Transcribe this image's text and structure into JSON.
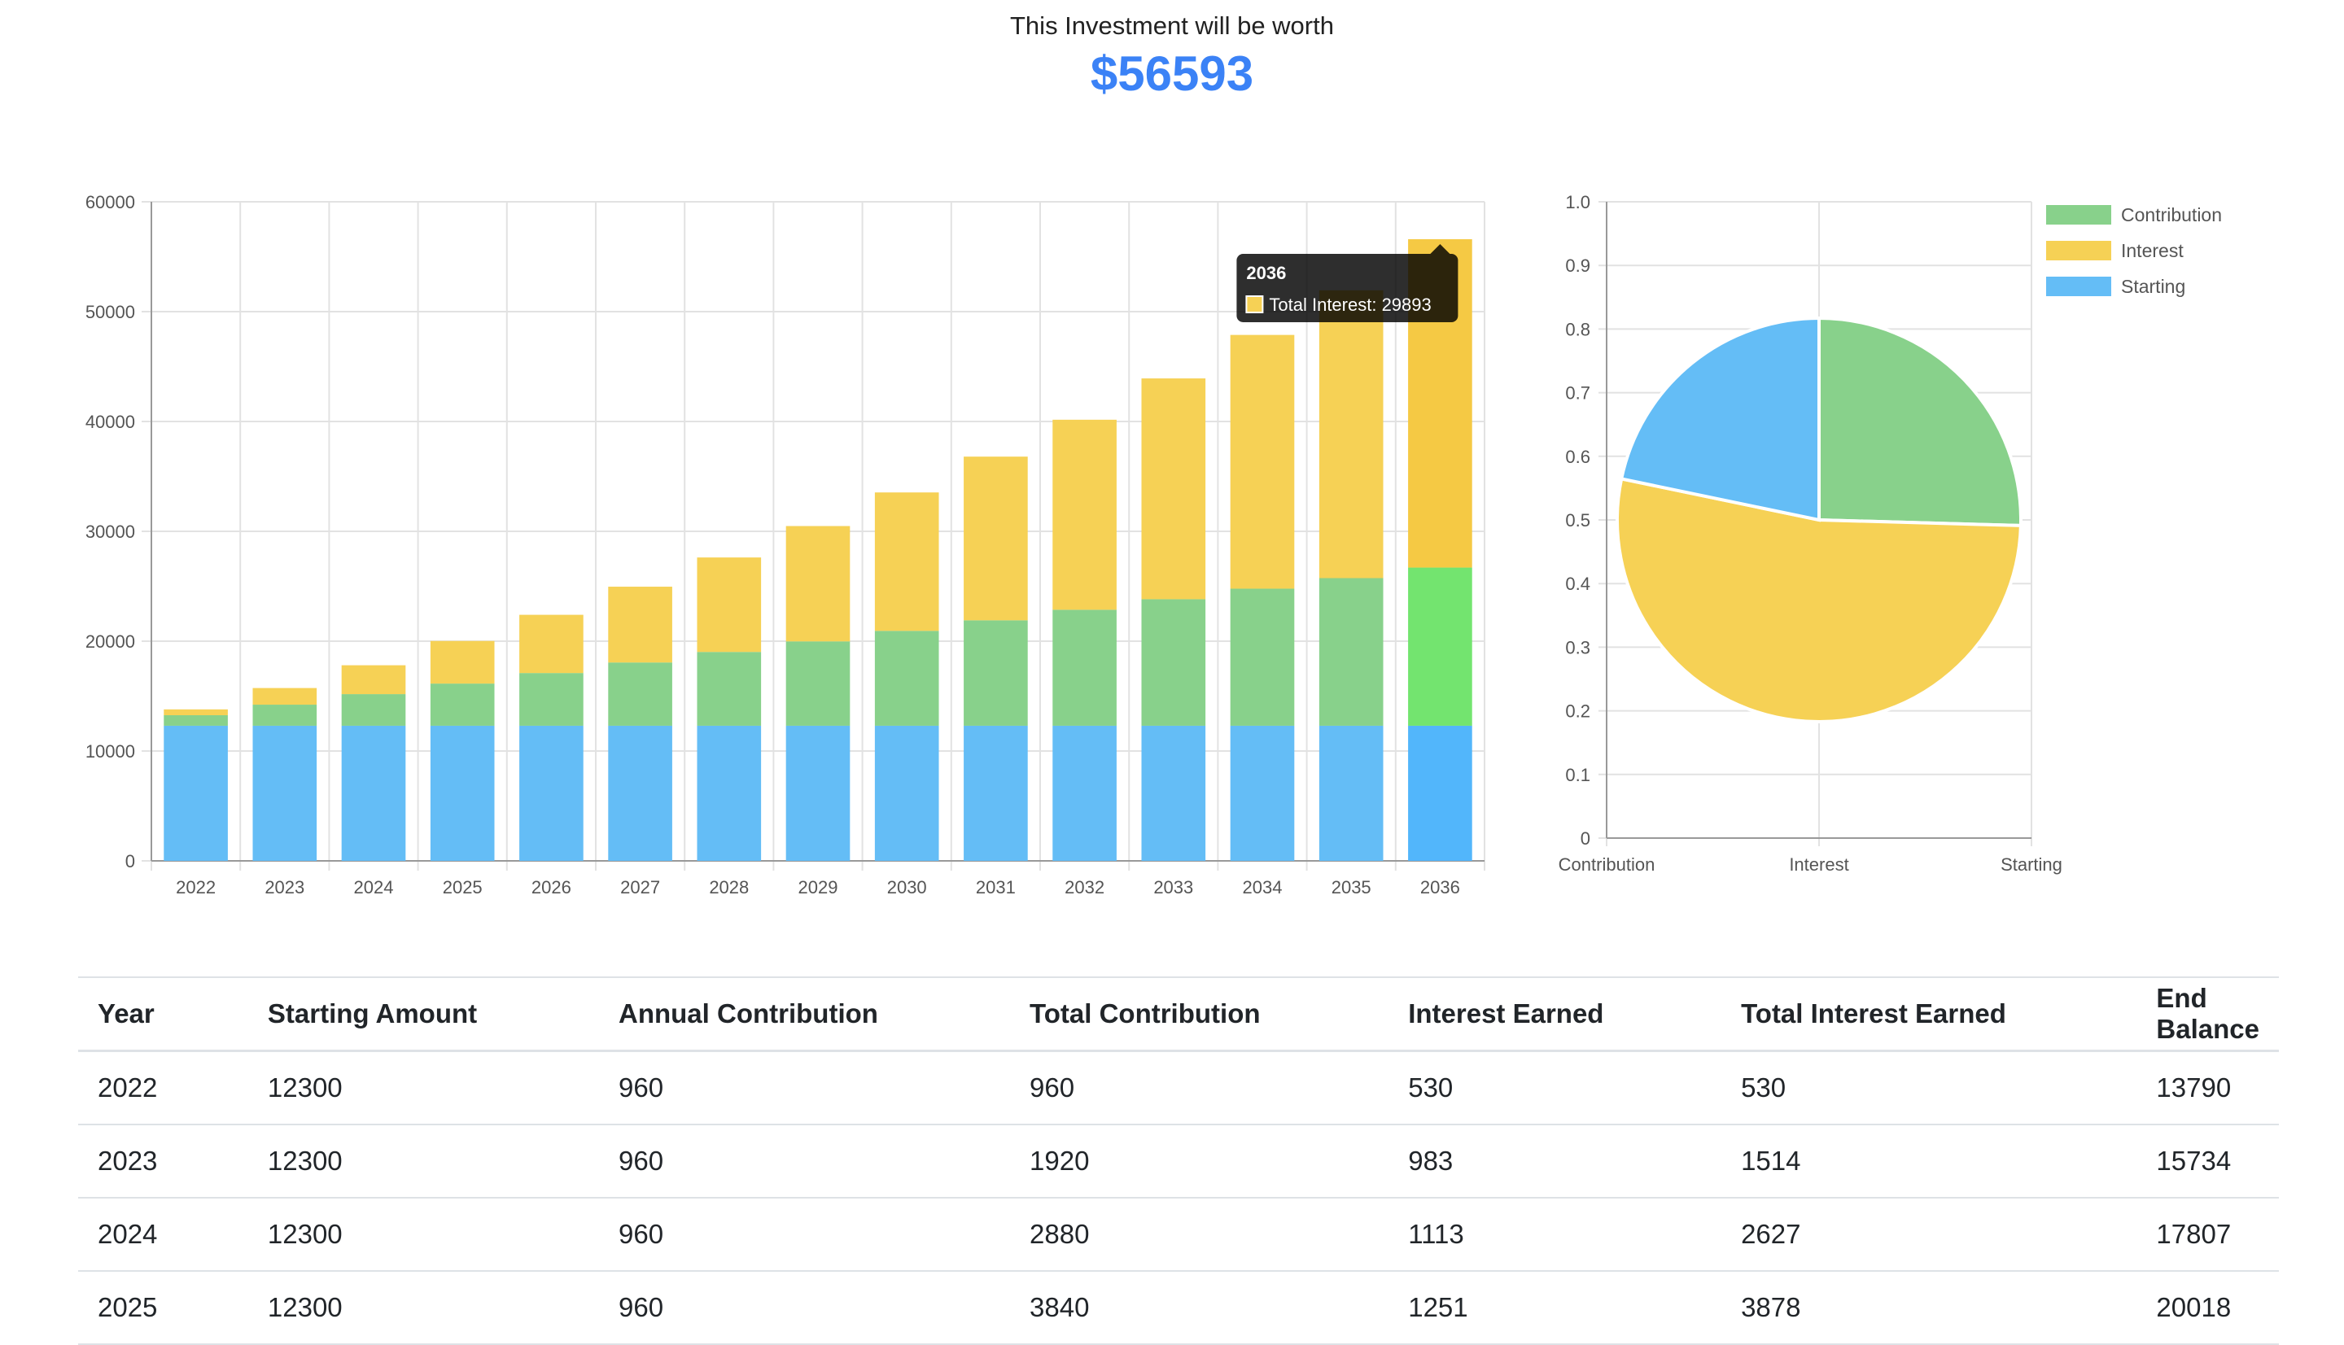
{
  "header": {
    "caption": "This Investment will be worth",
    "amount": "$56593"
  },
  "colors": {
    "contribution": "#88d18b",
    "interest": "#f6d155",
    "starting": "#64bdf6",
    "hl_contribution": "#73e46f",
    "hl_interest": "#f5c944",
    "hl_starting": "#52b6fb"
  },
  "chart_data": [
    {
      "type": "bar",
      "stacked": true,
      "categories": [
        "2022",
        "2023",
        "2024",
        "2025",
        "2026",
        "2027",
        "2028",
        "2029",
        "2030",
        "2031",
        "2032",
        "2033",
        "2034",
        "2035",
        "2036"
      ],
      "series": [
        {
          "name": "Starting",
          "values": [
            12300,
            12300,
            12300,
            12300,
            12300,
            12300,
            12300,
            12300,
            12300,
            12300,
            12300,
            12300,
            12300,
            12300,
            12300
          ]
        },
        {
          "name": "Contribution",
          "values": [
            960,
            1920,
            2880,
            3840,
            4800,
            5760,
            6720,
            7680,
            8640,
            9600,
            10560,
            11520,
            12480,
            13440,
            14400
          ]
        },
        {
          "name": "Interest",
          "values": [
            530,
            1514,
            2627,
            3878,
            5300,
            6900,
            8600,
            10500,
            12600,
            14900,
            17300,
            20100,
            23100,
            26200,
            29893
          ]
        }
      ],
      "ylim": [
        0,
        60000
      ],
      "yticks": [
        0,
        10000,
        20000,
        30000,
        40000,
        50000,
        60000
      ],
      "grid": true,
      "tooltip": {
        "category": "2036",
        "label": "Total Interest: 29893"
      }
    },
    {
      "type": "pie",
      "labels": [
        "Contribution",
        "Interest",
        "Starting"
      ],
      "values": [
        14400,
        29893,
        12300
      ],
      "axis_ticks": [
        "0",
        "0.1",
        "0.2",
        "0.3",
        "0.4",
        "0.5",
        "0.6",
        "0.7",
        "0.8",
        "0.9",
        "1.0"
      ],
      "x_labels": [
        "Contribution",
        "Interest",
        "Starting"
      ],
      "legend": [
        "Contribution",
        "Interest",
        "Starting"
      ],
      "legend_position": "top-right"
    }
  ],
  "table": {
    "headers": [
      "Year",
      "Starting Amount",
      "Annual Contribution",
      "Total Contribution",
      "Interest Earned",
      "Total Interest Earned",
      "End Balance"
    ],
    "rows": [
      [
        "2022",
        "12300",
        "960",
        "960",
        "530",
        "530",
        "13790"
      ],
      [
        "2023",
        "12300",
        "960",
        "1920",
        "983",
        "1514",
        "15734"
      ],
      [
        "2024",
        "12300",
        "960",
        "2880",
        "1113",
        "2627",
        "17807"
      ],
      [
        "2025",
        "12300",
        "960",
        "3840",
        "1251",
        "3878",
        "20018"
      ]
    ]
  }
}
